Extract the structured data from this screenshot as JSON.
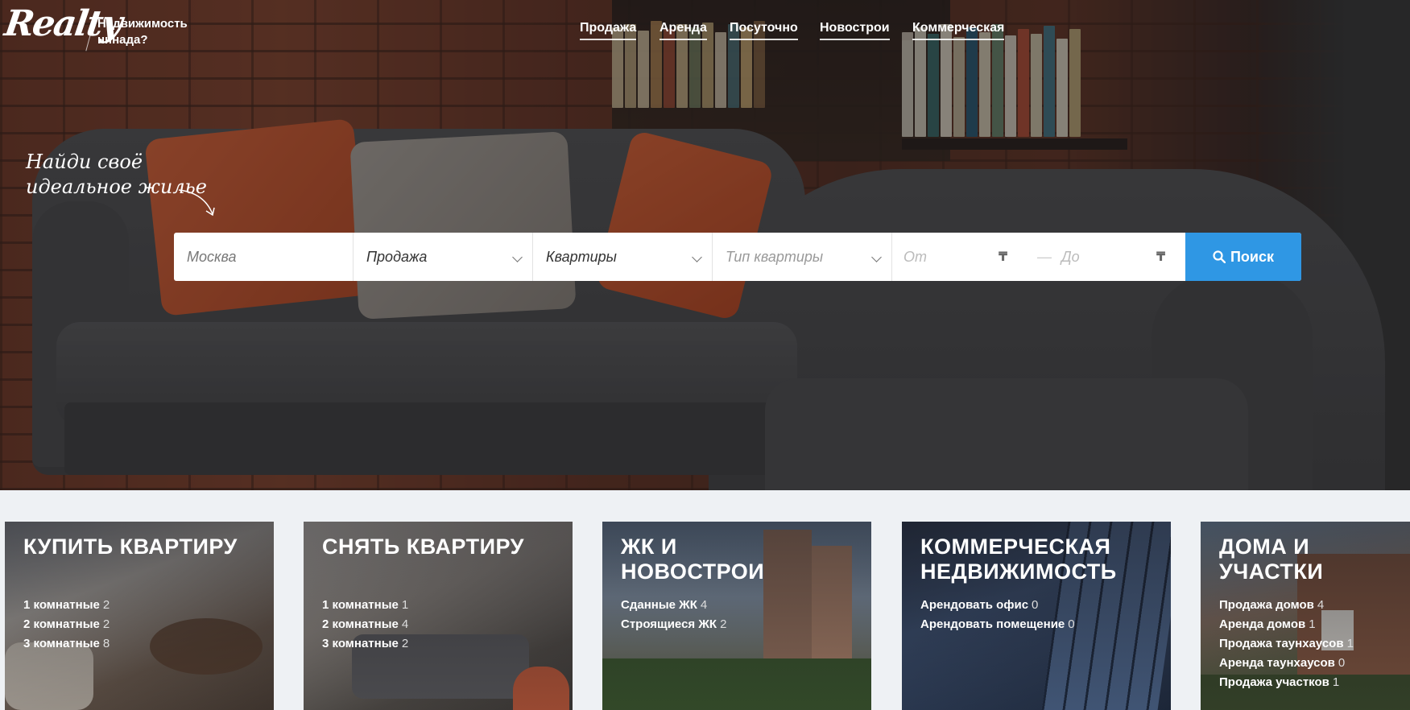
{
  "header": {
    "logo": "Realty",
    "tagline": "Недвижимость нннада?",
    "nav": [
      "Продажа",
      "Аренда",
      "Посуточно",
      "Новострои",
      "Коммерческая"
    ]
  },
  "hero": {
    "slogan_line1": "Найди своё",
    "slogan_line2": "идеальное жилье"
  },
  "search": {
    "city_placeholder": "Москва",
    "deal_value": "Продажа",
    "property_value": "Квартиры",
    "subtype_placeholder": "Тип квартиры",
    "price_from_placeholder": "От",
    "price_to_placeholder": "До",
    "currency_symbol": "₸",
    "separator": "—",
    "button_label": "Поиск"
  },
  "cards": [
    {
      "title": "Купить квартиру",
      "items": [
        {
          "label": "1 комнатные",
          "count": "2"
        },
        {
          "label": "2 комнатные",
          "count": "2"
        },
        {
          "label": "3 комнатные",
          "count": "8"
        }
      ]
    },
    {
      "title": "Снять квартиру",
      "items": [
        {
          "label": "1 комнатные",
          "count": "1"
        },
        {
          "label": "2 комнатные",
          "count": "4"
        },
        {
          "label": "3 комнатные",
          "count": "2"
        }
      ]
    },
    {
      "title": "ЖК и новострои",
      "items": [
        {
          "label": "Сданные ЖК",
          "count": "4"
        },
        {
          "label": "Строящиеся ЖК",
          "count": "2"
        }
      ]
    },
    {
      "title": "Коммерческая недвижимость",
      "items": [
        {
          "label": "Арендовать офис",
          "count": "0"
        },
        {
          "label": "Арендовать помещение",
          "count": "0"
        }
      ]
    },
    {
      "title": "Дома и участки",
      "items": [
        {
          "label": "Продажа домов",
          "count": "4"
        },
        {
          "label": "Аренда домов",
          "count": "1"
        },
        {
          "label": "Продажа таунхаусов",
          "count": "1"
        },
        {
          "label": "Аренда таунхаусов",
          "count": "0"
        },
        {
          "label": "Продажа участков",
          "count": "1"
        }
      ]
    }
  ],
  "colors": {
    "accent": "#2f97e4",
    "background": "#eef1f4"
  },
  "icons": {
    "search_button": "search-icon",
    "select": "chevron-down-icon"
  }
}
